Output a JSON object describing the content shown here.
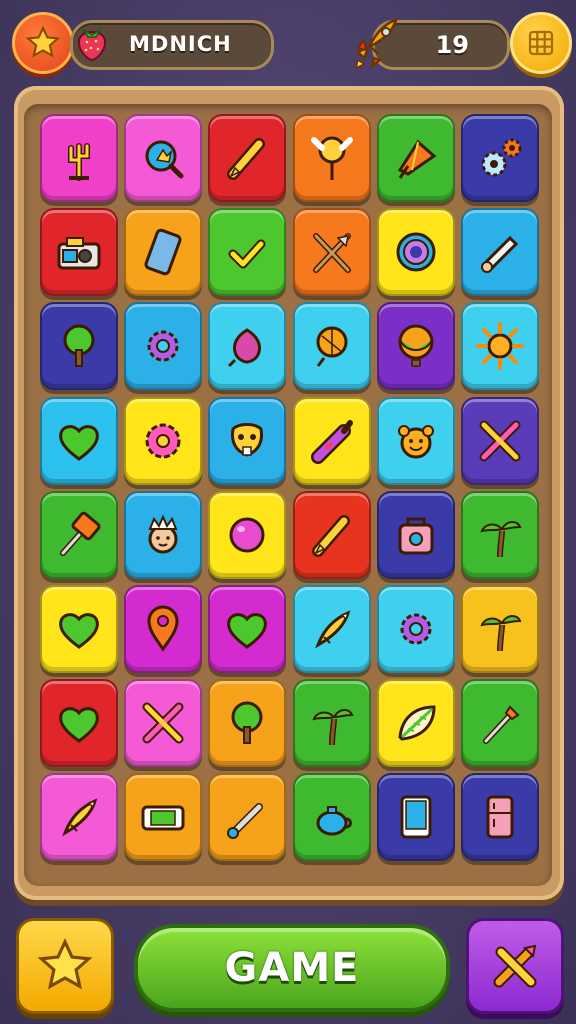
{
  "header": {
    "player_name": "MDNICH",
    "score": "19",
    "icons": [
      "star-icon",
      "strawberry-icon",
      "rocket-icon",
      "grid-menu-icon"
    ]
  },
  "board": {
    "rows": 8,
    "cols": 6,
    "tiles": [
      {
        "color": "#f03fc8",
        "icon": "cactus"
      },
      {
        "color": "#f45ad6",
        "icon": "search"
      },
      {
        "color": "#e0262a",
        "icon": "pencil"
      },
      {
        "color": "#f7791e",
        "icon": "lollipop"
      },
      {
        "color": "#3fb92f",
        "icon": "kite"
      },
      {
        "color": "#3a3aa8",
        "icon": "gears"
      },
      {
        "color": "#e0262a",
        "icon": "camera"
      },
      {
        "color": "#f7a21b",
        "icon": "phone"
      },
      {
        "color": "#4cc82e",
        "icon": "check"
      },
      {
        "color": "#f7791e",
        "icon": "crossed-arrows"
      },
      {
        "color": "#ffe51a",
        "icon": "target"
      },
      {
        "color": "#2cb0e8",
        "icon": "scroll"
      },
      {
        "color": "#3a3aa8",
        "icon": "tree"
      },
      {
        "color": "#2cb0e8",
        "icon": "gear"
      },
      {
        "color": "#3fd0f0",
        "icon": "onion"
      },
      {
        "color": "#3fd0f0",
        "icon": "balloon"
      },
      {
        "color": "#7b2fc7",
        "icon": "hot-air-balloon"
      },
      {
        "color": "#3fd0f0",
        "icon": "sun"
      },
      {
        "color": "#2cc0ee",
        "icon": "heart"
      },
      {
        "color": "#ffe51a",
        "icon": "flower"
      },
      {
        "color": "#2cb0e8",
        "icon": "mask"
      },
      {
        "color": "#ffe51a",
        "icon": "crayon"
      },
      {
        "color": "#3fd0f0",
        "icon": "bear-face"
      },
      {
        "color": "#5a3bb8",
        "icon": "crossed-sticks"
      },
      {
        "color": "#3fb92f",
        "icon": "hammer"
      },
      {
        "color": "#2cb0e8",
        "icon": "king-face"
      },
      {
        "color": "#ffe51a",
        "icon": "ball"
      },
      {
        "color": "#e8331e",
        "icon": "pencil"
      },
      {
        "color": "#3a3aa8",
        "icon": "bag"
      },
      {
        "color": "#3fb92f",
        "icon": "palm"
      },
      {
        "color": "#ffe51a",
        "icon": "heart"
      },
      {
        "color": "#d42bd1",
        "icon": "pin"
      },
      {
        "color": "#d42bd1",
        "icon": "heart"
      },
      {
        "color": "#3fd0f0",
        "icon": "rocket"
      },
      {
        "color": "#3fd0f0",
        "icon": "gear"
      },
      {
        "color": "#f7c21b",
        "icon": "palm"
      },
      {
        "color": "#e0262a",
        "icon": "heart"
      },
      {
        "color": "#f45ad6",
        "icon": "crossed-sticks"
      },
      {
        "color": "#f7a21b",
        "icon": "tree"
      },
      {
        "color": "#3fb92f",
        "icon": "palm"
      },
      {
        "color": "#ffe51a",
        "icon": "leaf"
      },
      {
        "color": "#3fb92f",
        "icon": "brush"
      },
      {
        "color": "#f45ad6",
        "icon": "rocket"
      },
      {
        "color": "#f7a21b",
        "icon": "console"
      },
      {
        "color": "#f7a21b",
        "icon": "wrench"
      },
      {
        "color": "#3fb92f",
        "icon": "teapot"
      },
      {
        "color": "#3a3aa8",
        "icon": "tablet"
      },
      {
        "color": "#3a3aa8",
        "icon": "fridge"
      }
    ]
  },
  "footer": {
    "game_label": "GAME",
    "icons": [
      "star-icon",
      "crossed-pencils-icon"
    ]
  }
}
